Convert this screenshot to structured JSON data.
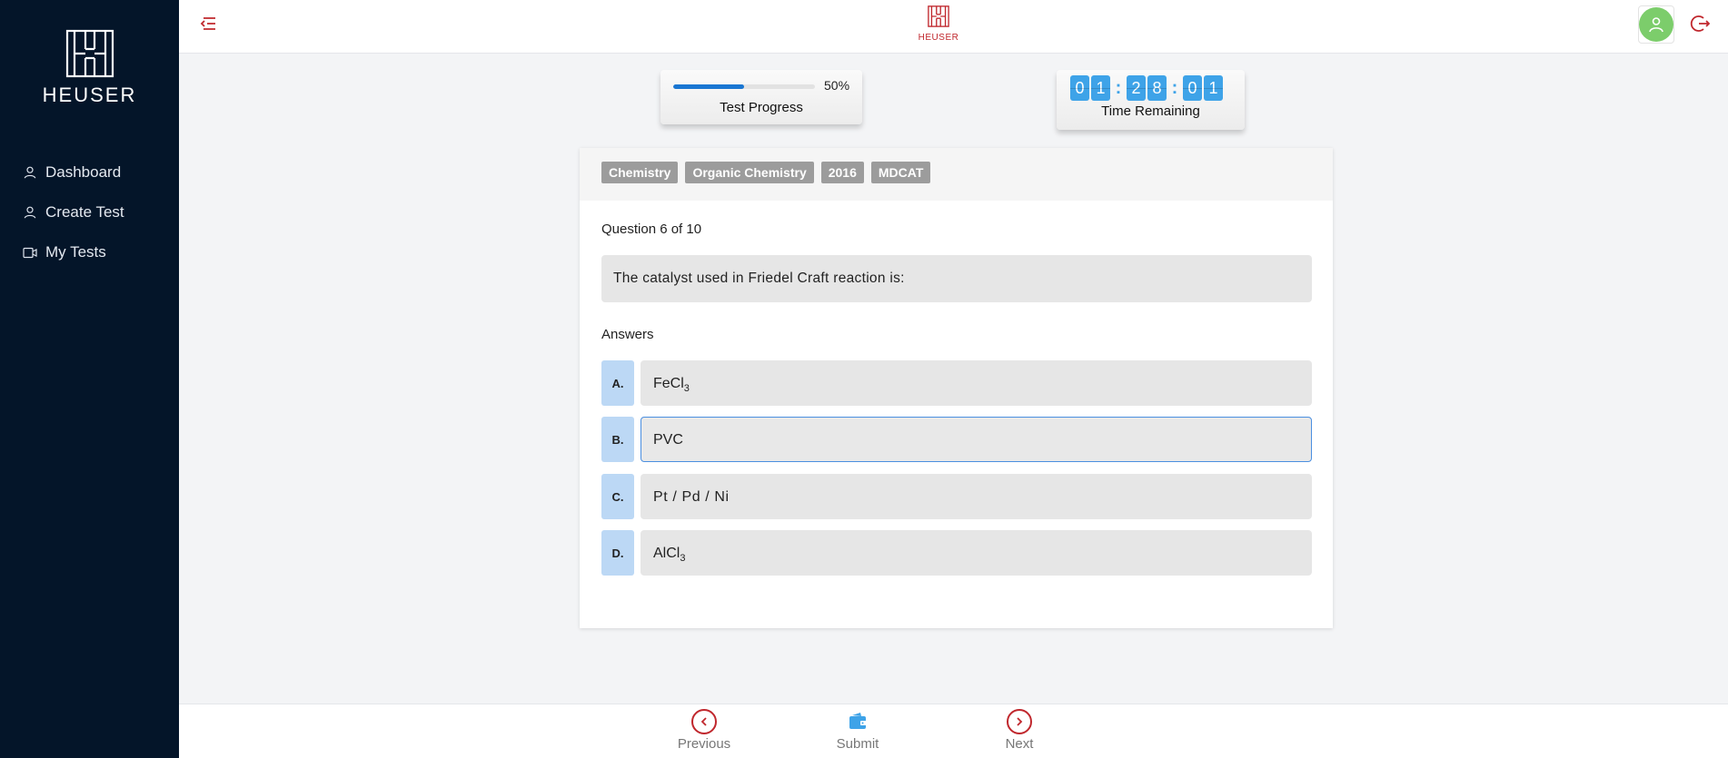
{
  "app": {
    "brand": "HEUSER",
    "brand_color": "#c0272d",
    "sidebar_bg": "#041529"
  },
  "sidebar": {
    "items": [
      {
        "label": "Dashboard",
        "icon": "user-icon"
      },
      {
        "label": "Create Test",
        "icon": "user-icon"
      },
      {
        "label": "My Tests",
        "icon": "video-icon"
      }
    ]
  },
  "topbar": {
    "brand": "HEUSER",
    "icons": [
      "menu-collapse-icon",
      "user-avatar-icon",
      "logout-icon"
    ]
  },
  "progress": {
    "value": 0.5,
    "percent_label": "50%",
    "label": "Test Progress",
    "color": "#1976d2"
  },
  "timer": {
    "d1": "0",
    "d2": "1",
    "d3": "2",
    "d4": "8",
    "d5": "0",
    "d6": "1",
    "sep": ":",
    "label": "Time Remaining",
    "color": "#3ea3e8"
  },
  "question": {
    "tags": [
      "Chemistry",
      "Organic Chemistry",
      "2016",
      "MDCAT"
    ],
    "number_label": "Question 6 of 10",
    "text": "The catalyst used in Friedel Craft reaction is:",
    "answers_label": "Answers",
    "answers": [
      {
        "letter": "A.",
        "text": "FeCl",
        "sub": "3"
      },
      {
        "letter": "B.",
        "text": "PVC",
        "sub": ""
      },
      {
        "letter": "C.",
        "text": "Pt / Pd / Ni",
        "sub": ""
      },
      {
        "letter": "D.",
        "text": "AlCl",
        "sub": "3"
      }
    ],
    "selected": "B."
  },
  "bottombar": {
    "previous": "Previous",
    "submit": "Submit",
    "next": "Next",
    "accent": "#c0272d",
    "submit_icon_color": "#3ea3e8"
  }
}
